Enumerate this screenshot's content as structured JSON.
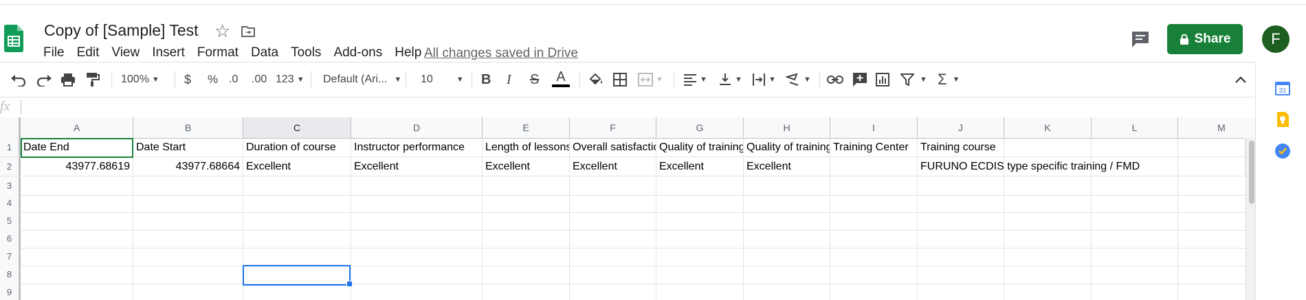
{
  "document": {
    "title": "Copy of [Sample] Test",
    "save_status": "All changes saved in Drive"
  },
  "menu": [
    "File",
    "Edit",
    "View",
    "Insert",
    "Format",
    "Data",
    "Tools",
    "Add-ons",
    "Help"
  ],
  "share": {
    "label": "Share",
    "color": "#188038"
  },
  "avatar": {
    "initial": "F",
    "color": "#1e5e20"
  },
  "toolbar": {
    "zoom": "100%",
    "currency": "$",
    "percent": "%",
    "decimal_decrease": ".0",
    "decimal_increase": ".00",
    "more_formats": "123",
    "font_family": "Default (Ari...",
    "font_size": "10",
    "bold": "B",
    "italic": "I",
    "strikethrough": "S",
    "text_color": "A",
    "function": "Σ"
  },
  "formula_bar": {
    "fx": "fx",
    "value": ""
  },
  "grid": {
    "columns": [
      "A",
      "B",
      "C",
      "D",
      "E",
      "F",
      "G",
      "H",
      "I",
      "J",
      "K",
      "L",
      "M"
    ],
    "rows": [
      "1",
      "2",
      "3",
      "4",
      "5",
      "6",
      "7",
      "8",
      "9"
    ],
    "header_row": [
      "Date End",
      "Date Start",
      "Duration of course",
      "Instructor performance",
      "Length of lessons",
      "Overall satisfaction",
      "Quality of training",
      "Quality of training",
      "Training Center",
      "Training course",
      "",
      "",
      ""
    ],
    "data_row": [
      "43977.68619",
      "43977.68664",
      "Excellent",
      "Excellent",
      "Excellent",
      "Excellent",
      "Excellent",
      "Excellent",
      "",
      "FURUNO ECDIS type specific training / FMD",
      "",
      "",
      ""
    ],
    "active_column": "C",
    "selected_cell": "C8"
  },
  "side_panel": {
    "calendar_label": "31"
  }
}
